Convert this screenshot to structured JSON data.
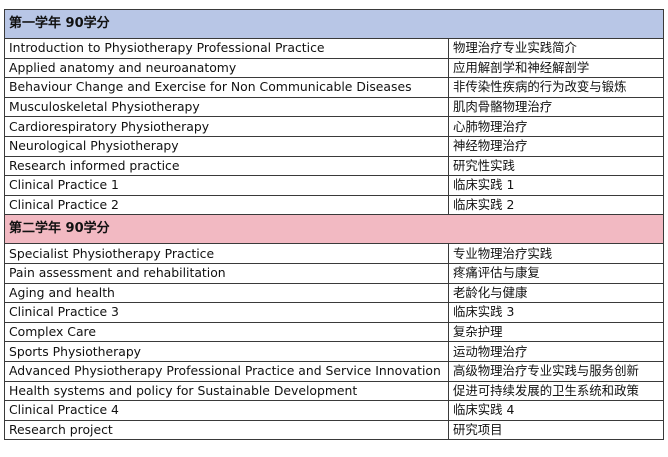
{
  "colors": {
    "year1_header_bg": "#b8c6e6",
    "year2_header_bg": "#f2b9c2",
    "border": "#3a3a3a"
  },
  "year1": {
    "title": "第一学年 90学分",
    "courses": [
      {
        "en": "Introduction to Physiotherapy Professional Practice",
        "zh": "物理治疗专业实践简介"
      },
      {
        "en": "Applied anatomy and neuroanatomy",
        "zh": "应用解剖学和神经解剖学"
      },
      {
        "en": "Behaviour Change and Exercise for Non Communicable Diseases",
        "zh": "非传染性疾病的行为改变与锻炼"
      },
      {
        "en": "Musculoskeletal Physiotherapy",
        "zh": "肌肉骨骼物理治疗"
      },
      {
        "en": "Cardiorespiratory Physiotherapy",
        "zh": "心肺物理治疗"
      },
      {
        "en": "Neurological Physiotherapy",
        "zh": "神经物理治疗"
      },
      {
        "en": "Research informed practice",
        "zh": "研究性实践"
      },
      {
        "en": "Clinical Practice 1",
        "zh": "临床实践 1"
      },
      {
        "en": "Clinical Practice 2",
        "zh": "临床实践 2"
      }
    ]
  },
  "year2": {
    "title": "第二学年 90学分",
    "courses": [
      {
        "en": "Specialist Physiotherapy Practice",
        "zh": "专业物理治疗实践"
      },
      {
        "en": "Pain assessment and rehabilitation",
        "zh": "疼痛评估与康复"
      },
      {
        "en": "Aging and health",
        "zh": "老龄化与健康"
      },
      {
        "en": "Clinical Practice 3",
        "zh": "临床实践 3"
      },
      {
        "en": "Complex Care",
        "zh": "复杂护理"
      },
      {
        "en": "Sports Physiotherapy",
        "zh": "运动物理治疗"
      },
      {
        "en": "Advanced Physiotherapy Professional Practice and Service Innovation",
        "zh": "高级物理治疗专业实践与服务创新"
      },
      {
        "en": "Health systems and policy for Sustainable Development",
        "zh": "促进可持续发展的卫生系统和政策"
      },
      {
        "en": "Clinical Practice 4",
        "zh": "临床实践 4"
      },
      {
        "en": "Research project",
        "zh": "研究项目"
      }
    ]
  }
}
